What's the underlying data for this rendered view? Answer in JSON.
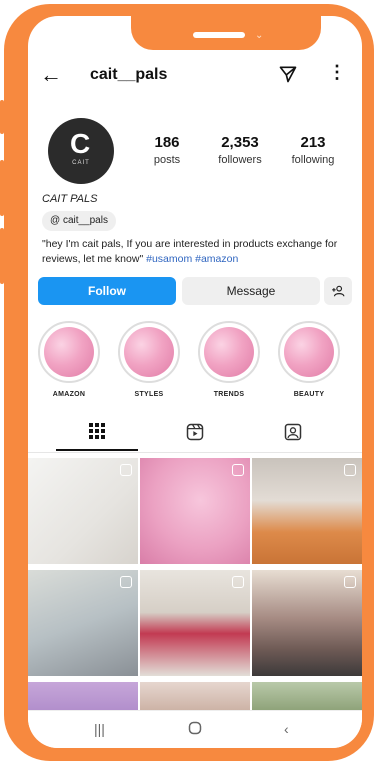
{
  "header": {
    "username": "cait__pals"
  },
  "avatar": {
    "text": "CAIT",
    "monogram": "C"
  },
  "stats": [
    {
      "value": "186",
      "label": "posts"
    },
    {
      "value": "2,353",
      "label": "followers"
    },
    {
      "value": "213",
      "label": "following"
    }
  ],
  "profile": {
    "display_name": "CAIT PALS",
    "threads_handle": "cait__pals",
    "bio": "\"hey I'm cait pals, If you are interested in products exchange for reviews, let me know\"",
    "hashtags": "#usamom #amazon"
  },
  "buttons": {
    "follow": "Follow",
    "message": "Message"
  },
  "highlights": [
    {
      "label": "AMAZON"
    },
    {
      "label": "STYLES"
    },
    {
      "label": "TRENDS"
    },
    {
      "label": "BEAUTY"
    }
  ],
  "colors": {
    "frame": "#f7893f",
    "follow": "#1a95f2",
    "hashtag": "#3066c0"
  }
}
